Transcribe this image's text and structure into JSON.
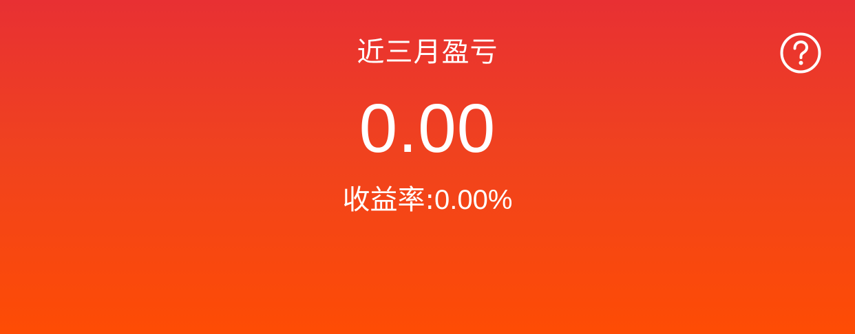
{
  "header": {
    "title": "近三月盈亏",
    "help_icon": "question-circle-icon"
  },
  "summary": {
    "amount": "0.00",
    "rate_label": "收益率:",
    "rate_value": "0.00%"
  },
  "colors": {
    "gradient_top": "#e83033",
    "gradient_bottom": "#fe4c04",
    "text": "#ffffff"
  }
}
